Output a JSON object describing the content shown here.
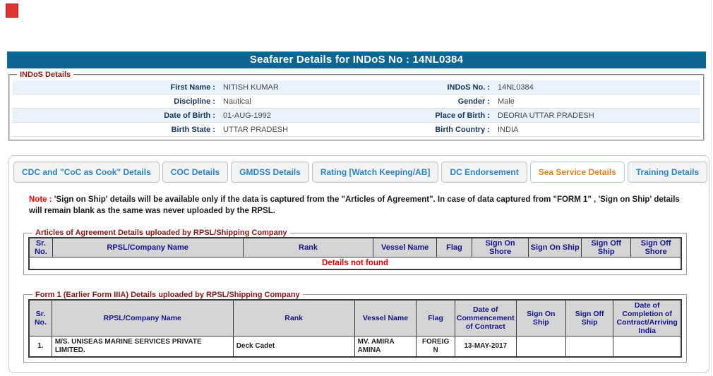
{
  "page": {
    "title": "Seafarer Details for INDoS No : 14NL0384"
  },
  "colors": {
    "title_bar": "#0d6593",
    "active_tab_text": "#e8821e",
    "tab_text": "#2a84c7",
    "legend_red": "#8b1515",
    "note_red": "#ff0000",
    "details_not_found_red": "#e60000",
    "row_alt_blue": "#e9f1fa",
    "table_header_bg": "#d4d4d4",
    "table_header_text": "#14148c"
  },
  "indos": {
    "legend": "INDoS Details",
    "rows": [
      {
        "left_label": "First Name : ",
        "left_value": "NITISH KUMAR",
        "right_label": "INDoS No. : ",
        "right_value": "14NL0384"
      },
      {
        "left_label": "Discipline : ",
        "left_value": "Nautical",
        "right_label": "Gender : ",
        "right_value": "Male"
      },
      {
        "left_label": "Date of Birth : ",
        "left_value": "01-AUG-1992",
        "right_label": "Place of Birth : ",
        "right_value": "DEORIA UTTAR PRADESH"
      },
      {
        "left_label": "Birth State : ",
        "left_value": "UTTAR PRADESH",
        "right_label": "Birth Country : ",
        "right_value": "INDIA"
      }
    ]
  },
  "tabs": [
    {
      "label": "CDC and \"CoC as Cook\" Details",
      "active": false
    },
    {
      "label": "COC Details",
      "active": false
    },
    {
      "label": "GMDSS Details",
      "active": false
    },
    {
      "label": "Rating [Watch Keeping/AB]",
      "active": false
    },
    {
      "label": "DC Endorsement",
      "active": false
    },
    {
      "label": "Sea Service Details",
      "active": true
    },
    {
      "label": "Training Details",
      "active": false
    }
  ],
  "note": {
    "prefix": "Note : ",
    "text": "'Sign on Ship' details will be available only if the data is captured from the \"Articles of Agreement\". In case of data captured from \"FORM 1\" , 'Sign on Ship' details will remain blank as the same was never uploaded by the RPSL."
  },
  "articles": {
    "legend": "Articles of Agreement Details uploaded by RPSL/Shipping Company",
    "headers": [
      "Sr. No.",
      "RPSL/Company Name",
      "Rank",
      "Vessel Name",
      "Flag",
      "Sign On Shore",
      "Sign On Ship",
      "Sign Off Ship",
      "Sign Off Shore"
    ],
    "col_widths": [
      "3.6%",
      "29.2%",
      "20.0%",
      "9.7%",
      "5.4%",
      "8.7%",
      "8.1%",
      "7.6%",
      "7.7%"
    ],
    "empty_message": "Details not found",
    "rows": []
  },
  "form1": {
    "legend": "Form 1 (Earlier Form IIIA) Details uploaded by RPSL/Shipping Company",
    "headers": [
      "Sr. No.",
      "RPSL/Company Name",
      "Rank",
      "Vessel Name",
      "Flag",
      "Date of Commencement of Contract",
      "Sign On Ship",
      "Sign Off Ship",
      "Date of Completion of Contract/Arriving India"
    ],
    "col_widths": [
      "3.5%",
      "27.8%",
      "18.6%",
      "9.5%",
      "5.9%",
      "9.4%",
      "7.6%",
      "7.3%",
      "10.4%"
    ],
    "rows": [
      [
        "1.",
        "M/S. UNISEAS MARINE SERVICES PRIVATE LIMITED.",
        "Deck Cadet",
        "MV. AMIRA AMINA",
        "FOREIGN",
        "13-MAY-2017",
        "",
        "",
        ""
      ]
    ]
  }
}
